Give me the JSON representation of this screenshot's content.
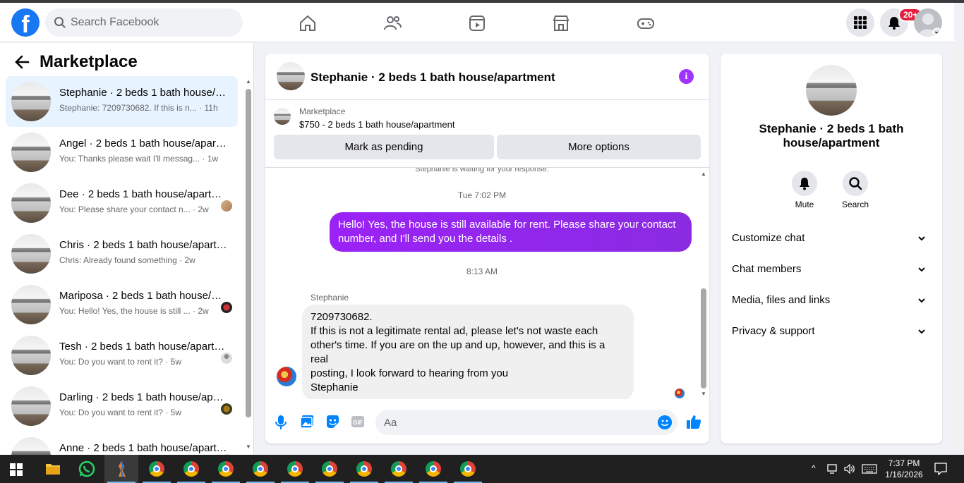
{
  "topbar": {
    "logo": "f",
    "search_placeholder": "Search Facebook",
    "notification_badge": "20+",
    "nav_icons": [
      "home-icon",
      "friends-icon",
      "watch-icon",
      "marketplace-icon",
      "gaming-icon"
    ]
  },
  "sidebar": {
    "title": "Marketplace",
    "conversations": [
      {
        "name": "Stephanie · 2 beds 1 bath house/apartment",
        "preview": "Stephanie: 7209730682. If this is n...",
        "time": "11h",
        "active": true
      },
      {
        "name": "Angel · 2 beds 1 bath house/apartment",
        "preview": "You: Thanks please wait I'll messag...",
        "time": "1w"
      },
      {
        "name": "Dee · 2 beds 1 bath house/apartment",
        "preview": "You: Please share your contact n...",
        "time": "2w"
      },
      {
        "name": "Chris · 2 beds 1 bath house/apartment",
        "preview": "Chris: Already found something",
        "time": "2w"
      },
      {
        "name": "Mariposa · 2 beds 1 bath house/apartment",
        "preview": "You: Hello! Yes, the house is still ...",
        "time": "2w"
      },
      {
        "name": "Tesh · 2 beds 1 bath house/apartment",
        "preview": "You: Do you want to rent it?",
        "time": "5w"
      },
      {
        "name": "Darling · 2 beds 1 bath house/apartment",
        "preview": "You: Do you want to rent it?",
        "time": "5w"
      },
      {
        "name": "Anne · 2 beds 1 bath house/apartment",
        "preview": "",
        "time": ""
      }
    ]
  },
  "chat": {
    "title": "Stephanie · 2 beds 1 bath house/apartment",
    "banner_label": "Marketplace",
    "listing": "$750 - 2 beds 1 bath house/apartment",
    "mark_pending": "Mark as pending",
    "more_options": "More options",
    "waiting": "Stephanie is waiting for your response.",
    "ts1": "Tue 7:02 PM",
    "outgoing": "Hello! Yes, the house is still available for rent. Please share your contact number, and I'll send you the details .",
    "ts2": "8:13 AM",
    "sender": "Stephanie",
    "incoming_lines": [
      "7209730682.",
      "If this is not a legitimate rental ad, please let's not waste each",
      "other's time. If you are on the up and up, however, and this is a real",
      "posting, I look forward to hearing from you",
      "Stephanie"
    ],
    "composer_placeholder": "Aa"
  },
  "details": {
    "name": "Stephanie · 2 beds 1 bath house/apartment",
    "mute": "Mute",
    "search": "Search",
    "sections": [
      "Customize chat",
      "Chat members",
      "Media, files and links",
      "Privacy & support"
    ]
  },
  "taskbar": {
    "time": "7:37 PM",
    "date": "1/16/2026"
  },
  "colors": {
    "brand": "#1877f2",
    "outgoing_bubble": "#8a2be2",
    "active_conv": "#e7f3ff"
  }
}
